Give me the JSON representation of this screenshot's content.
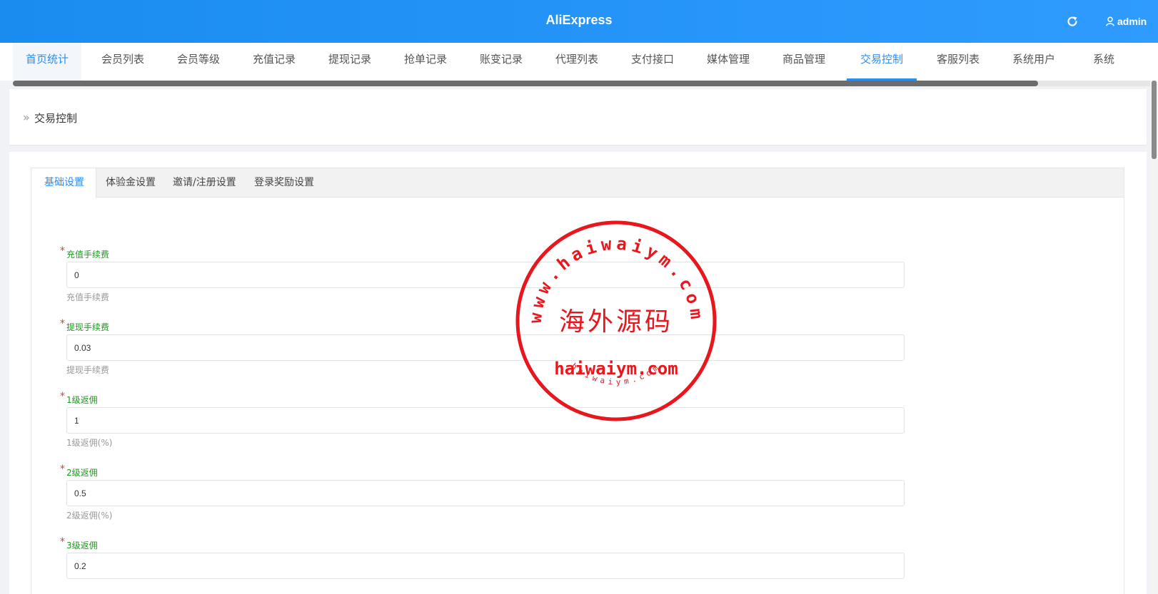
{
  "header": {
    "title": "AliExpress",
    "username": "admin",
    "refresh_icon": "refresh-icon",
    "user_icon": "user-icon",
    "brand_color": "#2d8cf0"
  },
  "nav": {
    "items": [
      {
        "label": "首页统计"
      },
      {
        "label": "会员列表"
      },
      {
        "label": "会员等级"
      },
      {
        "label": "充值记录"
      },
      {
        "label": "提现记录"
      },
      {
        "label": "抢单记录"
      },
      {
        "label": "账变记录"
      },
      {
        "label": "代理列表"
      },
      {
        "label": "支付接口"
      },
      {
        "label": "媒体管理"
      },
      {
        "label": "商品管理"
      },
      {
        "label": "交易控制"
      },
      {
        "label": "客服列表"
      },
      {
        "label": "系统用户"
      },
      {
        "label": "系统"
      }
    ],
    "active": "交易控制"
  },
  "breadcrumb": {
    "separator": "»",
    "current": "交易控制"
  },
  "tabs": {
    "items": [
      {
        "label": "基础设置"
      },
      {
        "label": "体验金设置"
      },
      {
        "label": "邀请/注册设置"
      },
      {
        "label": "登录奖励设置"
      }
    ],
    "active": "基础设置"
  },
  "form": {
    "fields": [
      {
        "label": "充值手续费",
        "value": "0",
        "hint": "充值手续费"
      },
      {
        "label": "提现手续费",
        "value": "0.03",
        "hint": "提现手续费"
      },
      {
        "label": "1级返佣",
        "value": "1",
        "hint": "1级返佣(%)"
      },
      {
        "label": "2级返佣",
        "value": "0.5",
        "hint": "2级返佣(%)"
      },
      {
        "label": "3级返佣",
        "value": "0.2",
        "hint": ""
      }
    ],
    "required_mark": "*"
  },
  "watermark": {
    "top_arc": "www.haiwaiym.com",
    "center": "海外源码",
    "domain": "haiwaiym.com",
    "bottom_arc": "haiwaiym.com",
    "color": "#e8161d"
  }
}
